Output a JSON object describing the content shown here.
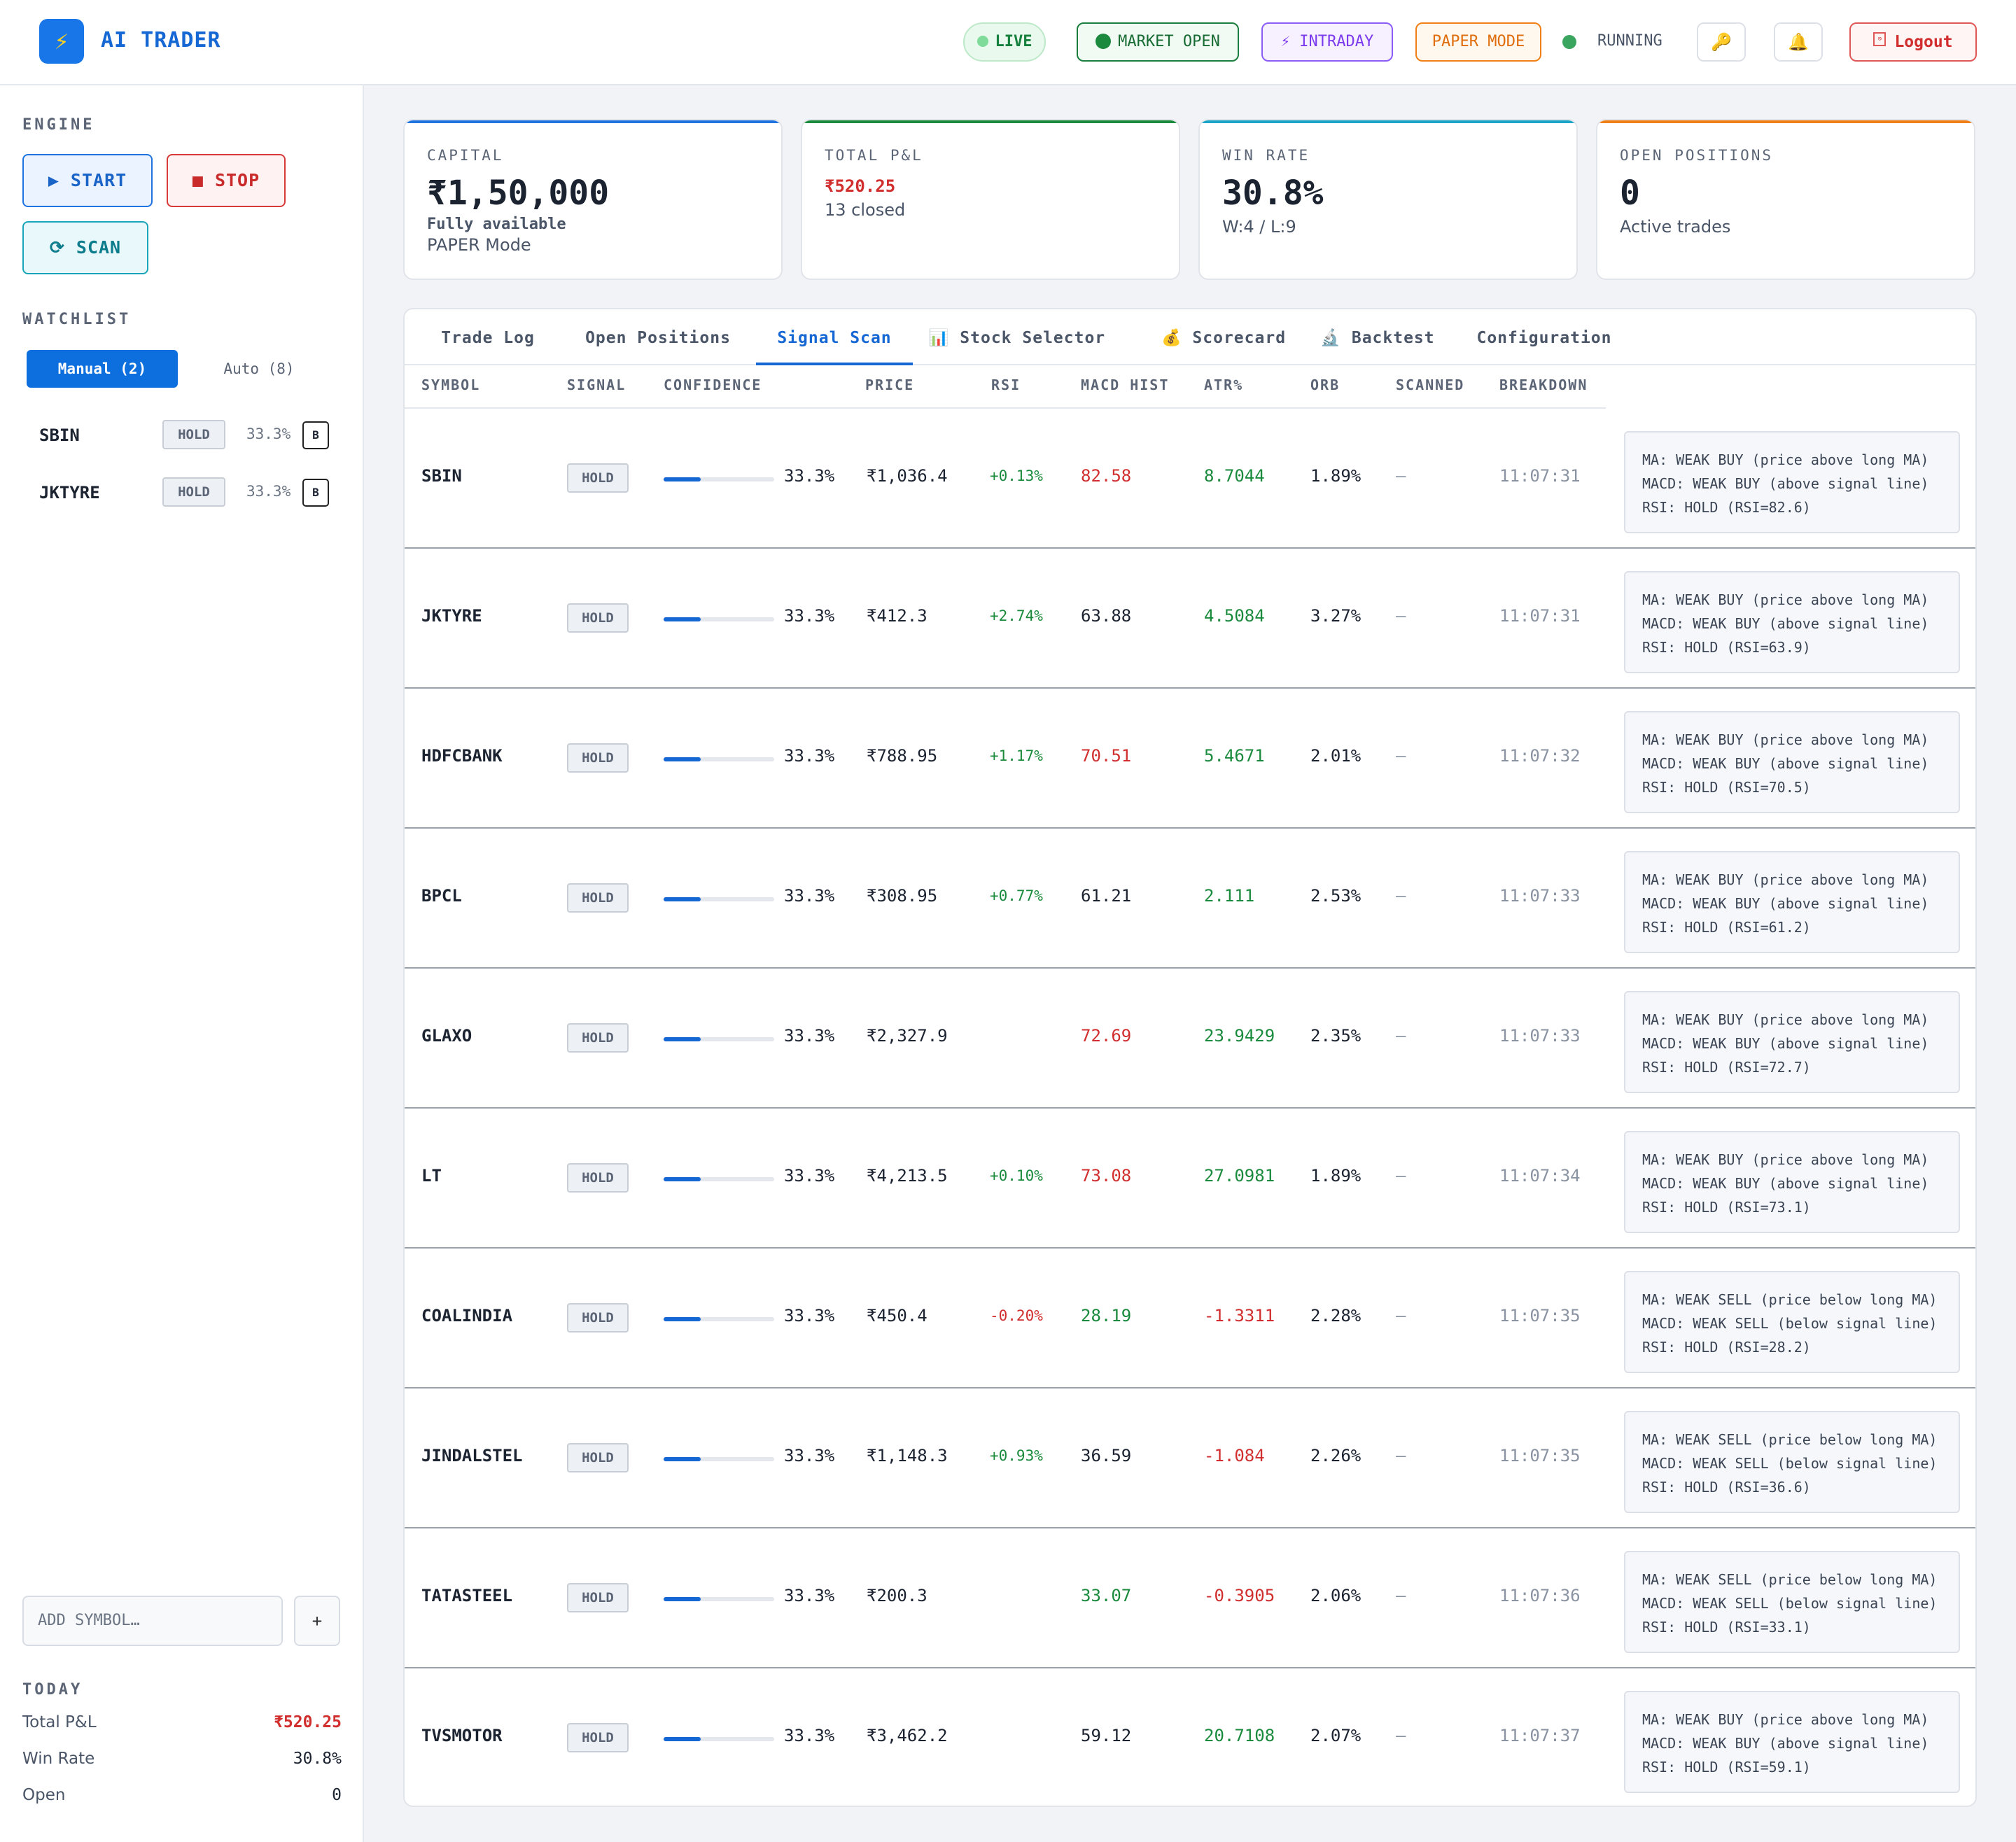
{
  "header": {
    "logo_icon": "⚡",
    "brand": "AI TRADER",
    "live": "LIVE",
    "market": "MARKET OPEN",
    "intraday": "⚡ INTRADAY",
    "paper": "PAPER MODE",
    "running": "RUNNING",
    "key_icon": "🔑",
    "bell_icon": "🔔",
    "logout": "Logout",
    "logout_icon": "⎋"
  },
  "sidebar": {
    "engine_title": "ENGINE",
    "start": "▶ START",
    "stop": "■ STOP",
    "scan": "⟳ SCAN",
    "watchlist_title": "WATCHLIST",
    "tab_manual": "Manual (2)",
    "tab_auto": "Auto (8)",
    "watchlist": [
      {
        "symbol": "SBIN",
        "signal": "HOLD",
        "confidence": "33.3%",
        "badge": "B"
      },
      {
        "symbol": "JKTYRE",
        "signal": "HOLD",
        "confidence": "33.3%",
        "badge": "B"
      }
    ],
    "add_placeholder": "ADD SYMBOL…",
    "add_button": "+",
    "today_title": "TODAY",
    "today": [
      {
        "label": "Total P&L",
        "value": "₹520.25",
        "color": "#d12e2e"
      },
      {
        "label": "Win Rate",
        "value": "30.8%",
        "color": "#1b2230"
      },
      {
        "label": "Open",
        "value": "0",
        "color": "#1b2230"
      }
    ]
  },
  "cards": [
    {
      "label": "CAPITAL",
      "value": "₹1,50,000",
      "sub1": "Fully available",
      "sub2": "PAPER Mode",
      "accent": "#1f74e0"
    },
    {
      "label": "TOTAL P&L",
      "value": "₹520.25",
      "sub1": "",
      "sub2": "13 closed",
      "accent": "#1a8a3c"
    },
    {
      "label": "WIN RATE",
      "value": "30.8%",
      "sub1": "",
      "sub2": "W:4 / L:9",
      "accent": "#1aa5c8"
    },
    {
      "label": "OPEN POSITIONS",
      "value": "0",
      "sub1": "",
      "sub2": "Active trades",
      "accent": "#ef7f16"
    }
  ],
  "tabs": [
    {
      "label": "Trade Log",
      "active": false
    },
    {
      "label": "Open Positions",
      "active": false
    },
    {
      "label": "Signal Scan",
      "active": true
    },
    {
      "label": "📊 Stock Selector",
      "active": false
    },
    {
      "label": "💰 Scorecard",
      "active": false
    },
    {
      "label": "🔬 Backtest",
      "active": false
    },
    {
      "label": "Configuration",
      "active": false
    }
  ],
  "columns": [
    "SYMBOL",
    "SIGNAL",
    "CONFIDENCE",
    "PRICE",
    "RSI",
    "MACD HIST",
    "ATR%",
    "ORB",
    "SCANNED",
    "BREAKDOWN"
  ],
  "rows": [
    {
      "symbol": "SBIN",
      "signal": "HOLD",
      "confidence": 33.3,
      "confidence_text": "33.3%",
      "price": "₹1,036.4",
      "change": "+0.13%",
      "change_color": "green",
      "rsi": "82.58",
      "rsi_color": "red",
      "macd": "8.7044",
      "macd_color": "green",
      "atr": "1.89%",
      "orb": "–",
      "time": "11:07:31",
      "breakdown": [
        "MA: WEAK BUY (price above long MA)",
        "MACD: WEAK BUY (above signal line)",
        "RSI: HOLD (RSI=82.6)"
      ]
    },
    {
      "symbol": "JKTYRE",
      "signal": "HOLD",
      "confidence": 33.3,
      "confidence_text": "33.3%",
      "price": "₹412.3",
      "change": "+2.74%",
      "change_color": "green",
      "rsi": "63.88",
      "rsi_color": "dark",
      "macd": "4.5084",
      "macd_color": "green",
      "atr": "3.27%",
      "orb": "–",
      "time": "11:07:31",
      "breakdown": [
        "MA: WEAK BUY (price above long MA)",
        "MACD: WEAK BUY (above signal line)",
        "RSI: HOLD (RSI=63.9)"
      ]
    },
    {
      "symbol": "HDFCBANK",
      "signal": "HOLD",
      "confidence": 33.3,
      "confidence_text": "33.3%",
      "price": "₹788.95",
      "change": "+1.17%",
      "change_color": "green",
      "rsi": "70.51",
      "rsi_color": "red",
      "macd": "5.4671",
      "macd_color": "green",
      "atr": "2.01%",
      "orb": "–",
      "time": "11:07:32",
      "breakdown": [
        "MA: WEAK BUY (price above long MA)",
        "MACD: WEAK BUY (above signal line)",
        "RSI: HOLD (RSI=70.5)"
      ]
    },
    {
      "symbol": "BPCL",
      "signal": "HOLD",
      "confidence": 33.3,
      "confidence_text": "33.3%",
      "price": "₹308.95",
      "change": "+0.77%",
      "change_color": "green",
      "rsi": "61.21",
      "rsi_color": "dark",
      "macd": "2.111",
      "macd_color": "green",
      "atr": "2.53%",
      "orb": "–",
      "time": "11:07:33",
      "breakdown": [
        "MA: WEAK BUY (price above long MA)",
        "MACD: WEAK BUY (above signal line)",
        "RSI: HOLD (RSI=61.2)"
      ]
    },
    {
      "symbol": "GLAXO",
      "signal": "HOLD",
      "confidence": 33.3,
      "confidence_text": "33.3%",
      "price": "₹2,327.9",
      "change": "",
      "change_color": "green",
      "rsi": "72.69",
      "rsi_color": "red",
      "macd": "23.9429",
      "macd_color": "green",
      "atr": "2.35%",
      "orb": "–",
      "time": "11:07:33",
      "breakdown": [
        "MA: WEAK BUY (price above long MA)",
        "MACD: WEAK BUY (above signal line)",
        "RSI: HOLD (RSI=72.7)"
      ]
    },
    {
      "symbol": "LT",
      "signal": "HOLD",
      "confidence": 33.3,
      "confidence_text": "33.3%",
      "price": "₹4,213.5",
      "change": "+0.10%",
      "change_color": "green",
      "rsi": "73.08",
      "rsi_color": "red",
      "macd": "27.0981",
      "macd_color": "green",
      "atr": "1.89%",
      "orb": "–",
      "time": "11:07:34",
      "breakdown": [
        "MA: WEAK BUY (price above long MA)",
        "MACD: WEAK BUY (above signal line)",
        "RSI: HOLD (RSI=73.1)"
      ]
    },
    {
      "symbol": "COALINDIA",
      "signal": "HOLD",
      "confidence": 33.3,
      "confidence_text": "33.3%",
      "price": "₹450.4",
      "change": "-0.20%",
      "change_color": "red",
      "rsi": "28.19",
      "rsi_color": "green",
      "macd": "-1.3311",
      "macd_color": "red",
      "atr": "2.28%",
      "orb": "–",
      "time": "11:07:35",
      "breakdown": [
        "MA: WEAK SELL (price below long MA)",
        "MACD: WEAK SELL (below signal line)",
        "RSI: HOLD (RSI=28.2)"
      ]
    },
    {
      "symbol": "JINDALSTEL",
      "signal": "HOLD",
      "confidence": 33.3,
      "confidence_text": "33.3%",
      "price": "₹1,148.3",
      "change": "+0.93%",
      "change_color": "green",
      "rsi": "36.59",
      "rsi_color": "dark",
      "macd": "-1.084",
      "macd_color": "red",
      "atr": "2.26%",
      "orb": "–",
      "time": "11:07:35",
      "breakdown": [
        "MA: WEAK SELL (price below long MA)",
        "MACD: WEAK SELL (below signal line)",
        "RSI: HOLD (RSI=36.6)"
      ]
    },
    {
      "symbol": "TATASTEEL",
      "signal": "HOLD",
      "confidence": 33.3,
      "confidence_text": "33.3%",
      "price": "₹200.3",
      "change": "",
      "change_color": "green",
      "rsi": "33.07",
      "rsi_color": "green",
      "macd": "-0.3905",
      "macd_color": "red",
      "atr": "2.06%",
      "orb": "–",
      "time": "11:07:36",
      "breakdown": [
        "MA: WEAK SELL (price below long MA)",
        "MACD: WEAK SELL (below signal line)",
        "RSI: HOLD (RSI=33.1)"
      ]
    },
    {
      "symbol": "TVSMOTOR",
      "signal": "HOLD",
      "confidence": 33.3,
      "confidence_text": "33.3%",
      "price": "₹3,462.2",
      "change": "",
      "change_color": "green",
      "rsi": "59.12",
      "rsi_color": "dark",
      "macd": "20.7108",
      "macd_color": "green",
      "atr": "2.07%",
      "orb": "–",
      "time": "11:07:37",
      "breakdown": [
        "MA: WEAK BUY (price above long MA)",
        "MACD: WEAK BUY (above signal line)",
        "RSI: HOLD (RSI=59.1)"
      ]
    }
  ]
}
